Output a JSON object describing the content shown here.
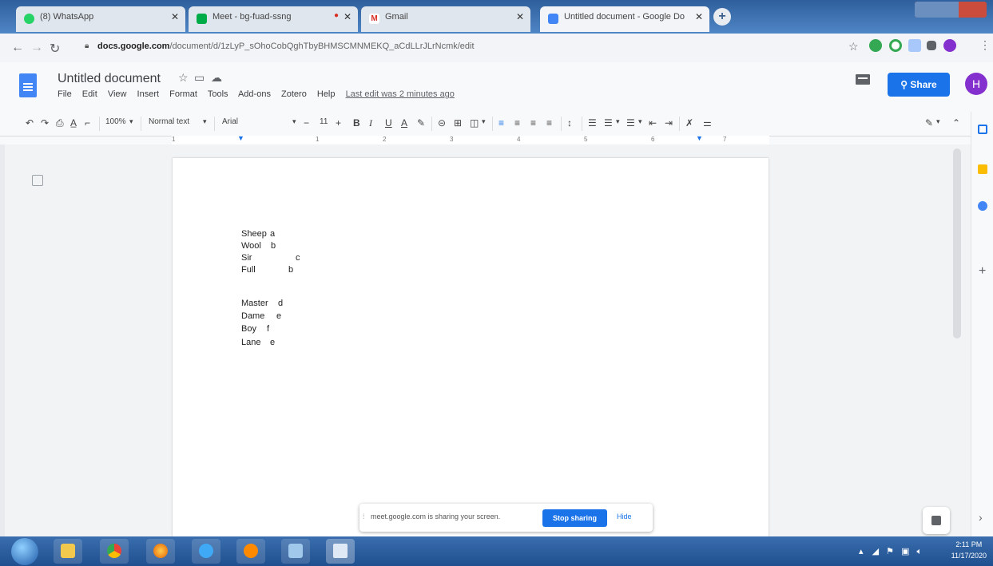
{
  "browser": {
    "tabs": [
      {
        "label": "(8) WhatsApp",
        "active": false
      },
      {
        "label": "Meet - bg-fuad-ssng",
        "active": false
      },
      {
        "label": "Gmail",
        "active": false
      },
      {
        "label": "Untitled document - Google Do",
        "active": true
      }
    ],
    "url_host": "docs.google.com",
    "url_path": "/document/d/1zLyP_sOhoCobQghTbyBHMSCMNMEKQ_aCdLLrJLrNcmk/edit"
  },
  "docs": {
    "title": "Untitled document",
    "menu": [
      "File",
      "Edit",
      "View",
      "Insert",
      "Format",
      "Tools",
      "Add-ons",
      "Zotero",
      "Help"
    ],
    "last_edit": "Last edit was 2 minutes ago",
    "share_label": "Share",
    "avatar_initial": "H"
  },
  "toolbar": {
    "zoom": "100%",
    "style": "Normal text",
    "font": "Arial",
    "font_size": "11",
    "bold": "B",
    "italic": "I",
    "underline": "U",
    "text_color": "A"
  },
  "ruler": {
    "marks": [
      "1",
      "1",
      "2",
      "3",
      "4",
      "5",
      "6",
      "7"
    ]
  },
  "document": {
    "lines": [
      {
        "word": "Sheep",
        "letter": "a"
      },
      {
        "word": "Wool",
        "letter": "b"
      },
      {
        "word": "Sir",
        "letter": "c"
      },
      {
        "word": "Full",
        "letter": "b"
      },
      {
        "word": "",
        "letter": ""
      },
      {
        "word": "Master",
        "letter": "d"
      },
      {
        "word": "Dame",
        "letter": "e"
      },
      {
        "word": "Boy",
        "letter": "f"
      },
      {
        "word": "Lane",
        "letter": "e"
      }
    ]
  },
  "share_banner": {
    "text": "meet.google.com is sharing your screen.",
    "stop_label": "Stop sharing",
    "hide_label": "Hide"
  },
  "taskbar": {
    "time": "2:11 PM",
    "date": "11/17/2020"
  }
}
